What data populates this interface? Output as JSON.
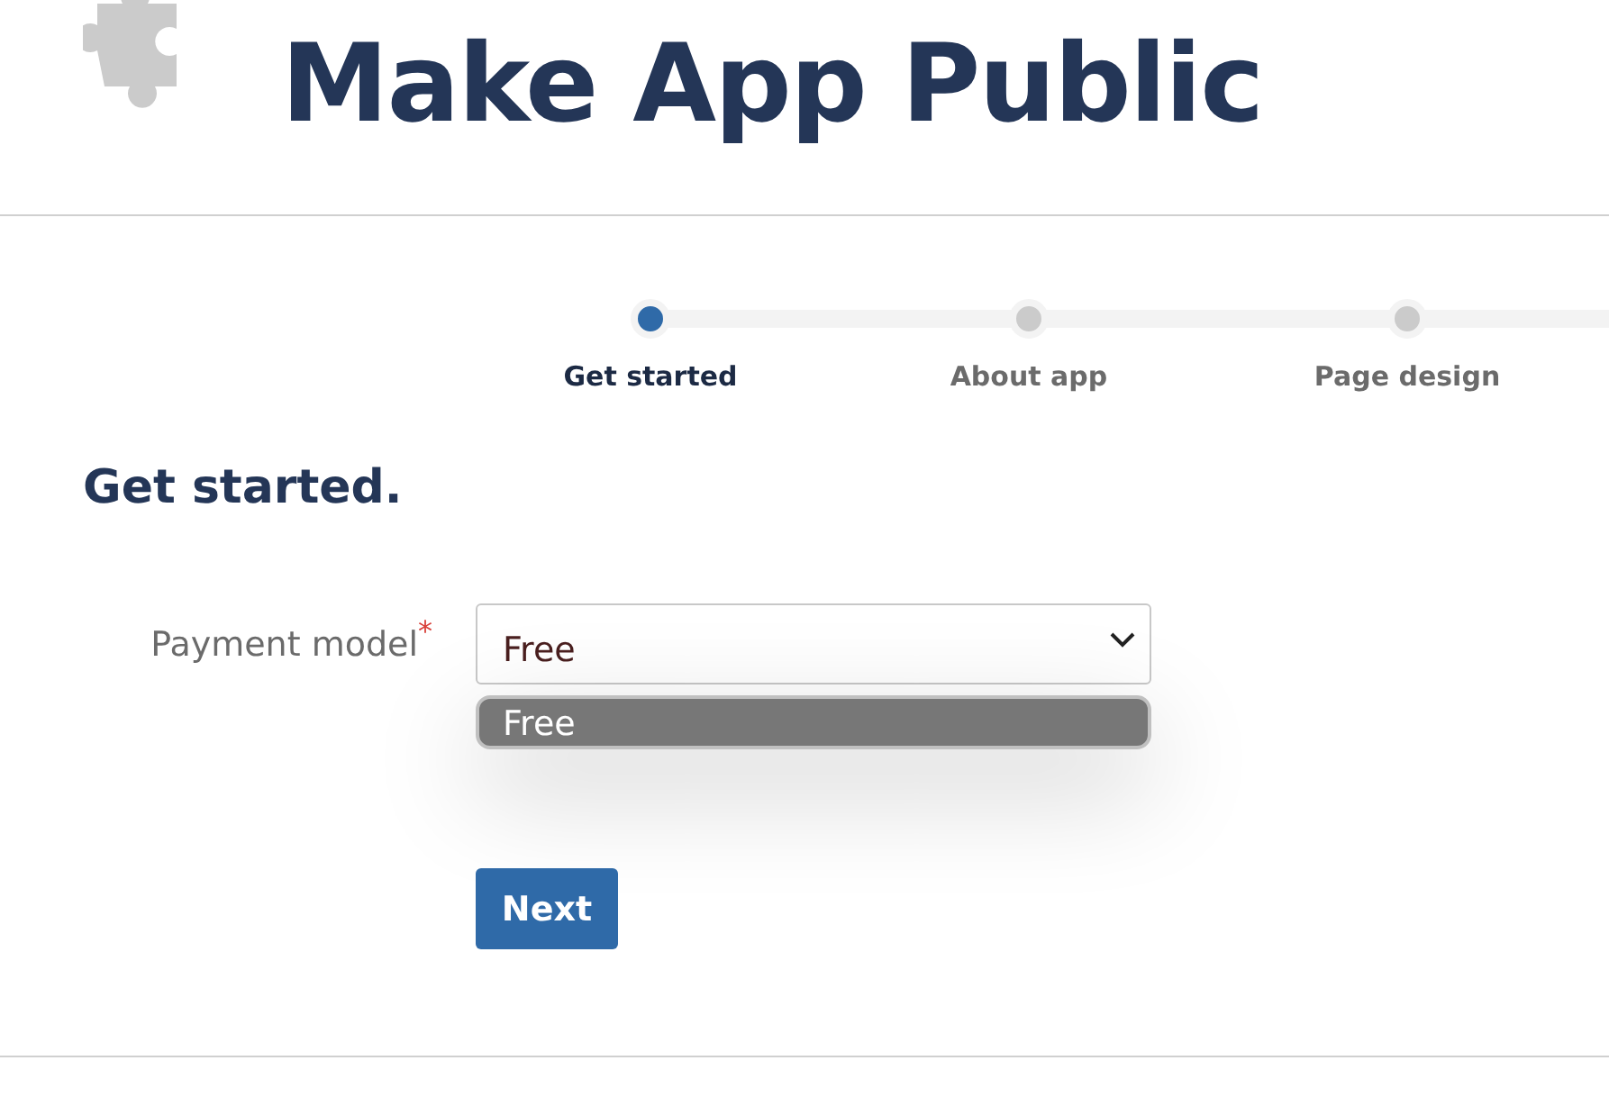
{
  "header": {
    "title": "Make App Public"
  },
  "steps": [
    {
      "label": "Get started",
      "selected": true
    },
    {
      "label": "About app",
      "selected": false
    },
    {
      "label": "Page design",
      "selected": false
    }
  ],
  "section_title": "Get started.",
  "form": {
    "field_label": "Payment model",
    "required_mark": "*",
    "value": "Free",
    "expanded": true,
    "options": [
      {
        "label": "Free",
        "selected": true
      }
    ]
  },
  "buttons": [
    "Next"
  ]
}
